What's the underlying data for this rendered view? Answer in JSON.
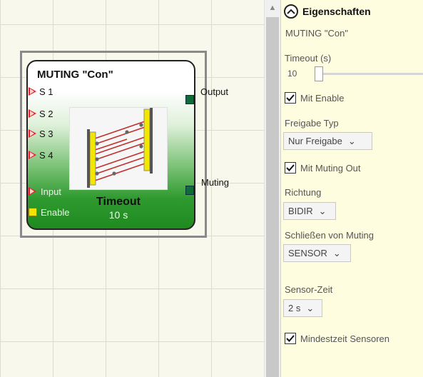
{
  "block": {
    "title": "MUTING \"Con\"",
    "inputs": [
      "S 1",
      "S 2",
      "S 3",
      "S 4",
      "Input"
    ],
    "enable_label": "Enable",
    "outputs": [
      "Output",
      "Muting"
    ],
    "timeout_label": "Timeout",
    "timeout_value": "10 s"
  },
  "panel": {
    "title": "Eigenschaften",
    "subtitle": "MUTING \"Con\"",
    "timeout_label": "Timeout (s)",
    "timeout_value": "10",
    "mit_enable": "Mit Enable",
    "freigabe_typ_label": "Freigabe Typ",
    "freigabe_typ_value": "Nur Freigabe",
    "mit_muting_out": "Mit Muting Out",
    "richtung_label": "Richtung",
    "richtung_value": "BIDIR",
    "schliessen_label": "Schließen von Muting",
    "schliessen_value": "SENSOR",
    "sensor_zeit_label": "Sensor-Zeit",
    "sensor_zeit_value": "2 s",
    "mindestzeit": "Mindestzeit Sensoren"
  },
  "colors": {
    "input_pin": "#e8202a",
    "enable_pin": "#f5e400",
    "output_pin": "#0f6b3a",
    "panel_bg": "#fffde0"
  }
}
